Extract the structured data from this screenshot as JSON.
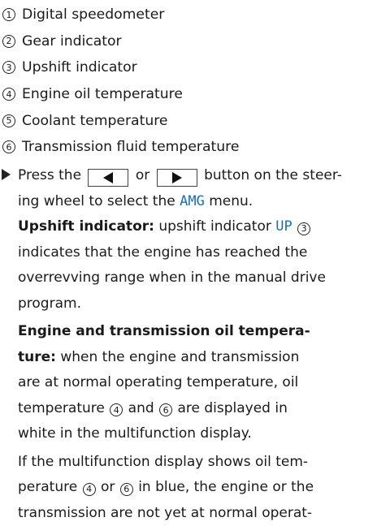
{
  "legend": [
    {
      "num": "1",
      "text": "Digital speedometer"
    },
    {
      "num": "2",
      "text": "Gear indicator"
    },
    {
      "num": "3",
      "text": "Upshift indicator"
    },
    {
      "num": "4",
      "text": "Engine oil temperature"
    },
    {
      "num": "5",
      "text": "Coolant temperature"
    },
    {
      "num": "6",
      "text": "Transmission fluid temperature"
    }
  ],
  "instruction": {
    "prefix": "Press the",
    "or": "or",
    "suffix_1": "button on the steer-",
    "line2_prefix": "ing wheel to select the",
    "menu_name": "AMG",
    "line2_suffix": "menu.",
    "buttons": {
      "left": "left-arrow-icon",
      "right": "right-arrow-icon"
    }
  },
  "upshift": {
    "heading": "Upshift indicator:",
    "text_1": "upshift indicator",
    "code": "UP",
    "ref": "3",
    "text_2": "indicates that the engine has reached the",
    "line3": "overrevving range when in the manual drive",
    "line4": "program."
  },
  "engine_trans": {
    "heading_1": "Engine and transmission oil tempera-",
    "heading_2": "ture:",
    "text_1": "when the engine and transmission",
    "line3": "are at normal operating temperature, oil",
    "line4_prefix": "temperature",
    "ref_a": "4",
    "and": "and",
    "ref_b": "6",
    "line4_suffix": "are displayed in",
    "line5": "white in the multifunction display."
  },
  "blue_note": {
    "line1": "If the multifunction display shows oil tem-",
    "line2_prefix": "perature",
    "ref_a": "4",
    "or": "or",
    "ref_b": "6",
    "line2_suffix": "in blue, the engine or the",
    "line3": "transmission are not yet at normal operat-"
  }
}
